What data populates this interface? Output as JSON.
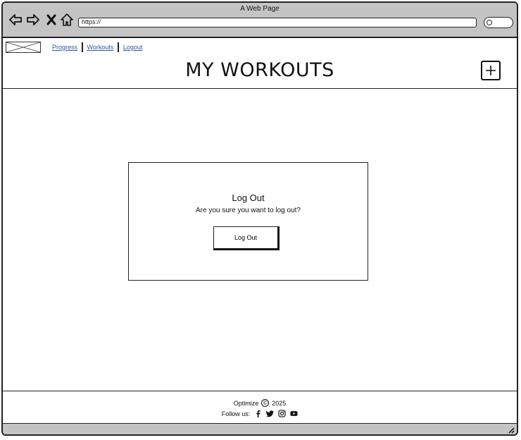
{
  "browser": {
    "window_title": "A Web Page",
    "url": "https://",
    "icons": [
      "back-arrow-icon",
      "forward-arrow-icon",
      "close-x-icon",
      "home-icon",
      "search-icon"
    ]
  },
  "header": {
    "nav": [
      {
        "label": "Progress"
      },
      {
        "label": "Workouts"
      },
      {
        "label": "Logout"
      }
    ],
    "title": "MY WORKOUTS",
    "add_icon": "plus-icon"
  },
  "modal": {
    "title": "Log Out",
    "message": "Are you sure you want to log out?",
    "button_label": "Log Out"
  },
  "footer": {
    "brand": "Optimize",
    "copyright_symbol": "©",
    "year": "2025",
    "follow_label": "Follow us:",
    "social_icons": [
      "facebook-icon",
      "twitter-icon",
      "instagram-icon",
      "youtube-icon"
    ]
  },
  "colors": {
    "chrome_gray": "#c4c4c4",
    "link_blue": "#2a5aa0",
    "border": "#222222"
  }
}
